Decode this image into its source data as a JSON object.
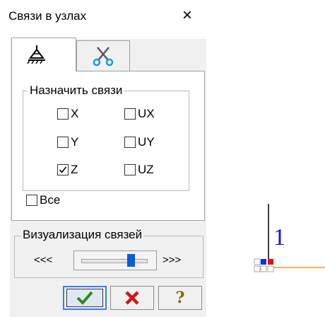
{
  "window": {
    "title": "Связи в узлах",
    "close_glyph": "×"
  },
  "tabs": [
    {
      "icon": "support-constraint-icon",
      "active": true
    },
    {
      "icon": "scissors-icon",
      "active": false
    }
  ],
  "assign_group": {
    "legend": "Назначить связи",
    "checkboxes": [
      {
        "label": "X",
        "checked": false
      },
      {
        "label": "UX",
        "checked": false
      },
      {
        "label": "Y",
        "checked": false
      },
      {
        "label": "UY",
        "checked": false
      },
      {
        "label": "Z",
        "checked": true
      },
      {
        "label": "UZ",
        "checked": false
      }
    ]
  },
  "all_checkbox": {
    "label": "Все",
    "checked": false
  },
  "visualization": {
    "legend": "Визуализация связей",
    "left_arrow": "<<<",
    "right_arrow": ">>>",
    "slider_level": 0.8
  },
  "buttons": {
    "ok_icon": "checkmark-icon",
    "cancel_icon": "red-x-icon",
    "help_label": "?"
  },
  "viewport": {
    "node_number": "1",
    "colors": {
      "node_number": "#1010e0",
      "member_line": "#f0a020",
      "dof_blue": "#1030e0",
      "dof_red": "#e01010"
    }
  }
}
